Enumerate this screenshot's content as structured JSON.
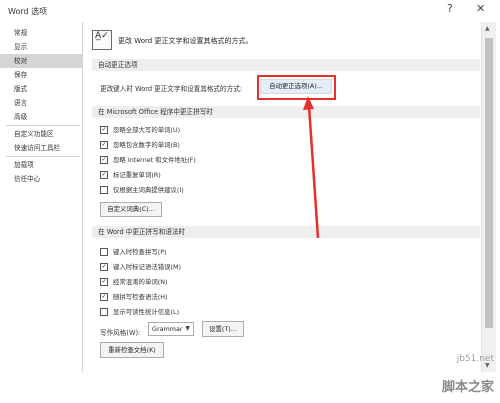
{
  "window": {
    "title": "Word 选项",
    "help": "?",
    "close": "✕"
  },
  "sidebar": {
    "items": [
      {
        "label": "常规"
      },
      {
        "label": "显示"
      },
      {
        "label": "校对",
        "selected": true
      },
      {
        "label": "保存"
      },
      {
        "label": "版式"
      },
      {
        "label": "语言"
      },
      {
        "label": "高级"
      },
      {
        "label": "自定义功能区"
      },
      {
        "label": "快速访问工具栏"
      },
      {
        "label": "加载项"
      },
      {
        "label": "信任中心"
      }
    ]
  },
  "header": {
    "icon": "abc-check-icon",
    "icon_text": "A̲✓",
    "text": "更改 Word 更正文字和设置其格式的方式。"
  },
  "autocorrect": {
    "section_title": "自动更正选项",
    "label": "更改键入时 Word 更正文字和设置其格式的方式:",
    "button": "自动更正选项(A)..."
  },
  "office_spelling": {
    "section_title": "在 Microsoft Office 程序中更正拼写时",
    "options": [
      {
        "label": "忽略全部大写的单词(U)",
        "checked": true
      },
      {
        "label": "忽略包含数字的单词(B)",
        "checked": true
      },
      {
        "label": "忽略 Internet 和文件地址(F)",
        "checked": true
      },
      {
        "label": "标记重复单词(R)",
        "checked": true
      },
      {
        "label": "仅根据主词典提供建议(I)",
        "checked": false
      }
    ],
    "dict_button": "自定义词典(C)..."
  },
  "word_spelling": {
    "section_title": "在 Word 中更正拼写和语法时",
    "options": [
      {
        "label": "键入时检查拼写(P)",
        "checked": false
      },
      {
        "label": "键入时标记语法错误(M)",
        "checked": true
      },
      {
        "label": "经常混淆的单词(N)",
        "checked": true
      },
      {
        "label": "随拼写检查语法(H)",
        "checked": true
      },
      {
        "label": "显示可读性统计信息(L)",
        "checked": false
      }
    ],
    "style_label": "写作风格(W):",
    "style_value": "Grammar",
    "settings_button": "设置(T)...",
    "recheck_button": "重新检查文档(K)"
  },
  "watermark": {
    "site": "jb51.net",
    "name": "脚本之家"
  },
  "colors": {
    "highlight": "#e5312b",
    "selected_bg": "#d5d5d5",
    "section_bg": "#eeeeee"
  }
}
